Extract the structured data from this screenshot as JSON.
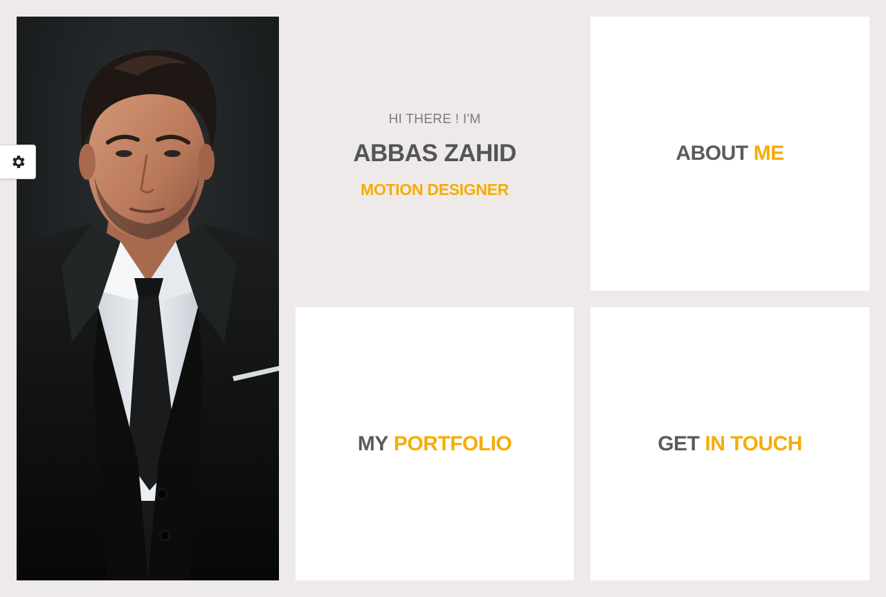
{
  "profile": {
    "greeting": "HI THERE ! I'M",
    "name": "ABBAS ZAHID",
    "role": "MOTION DESIGNER",
    "photo_icon": "portrait-photo"
  },
  "settings": {
    "icon": "gear-icon"
  },
  "tiles": {
    "about": {
      "word1": "ABOUT",
      "word2": "ME"
    },
    "portfolio": {
      "word1": "MY",
      "word2": "PORTFOLIO"
    },
    "contact": {
      "word1": "GET",
      "word2": "IN TOUCH"
    }
  },
  "colors": {
    "background": "#efeaea",
    "accent": "#f5ad05",
    "heading": "#555555",
    "muted": "#7a7a7a",
    "tile": "#ffffff"
  }
}
